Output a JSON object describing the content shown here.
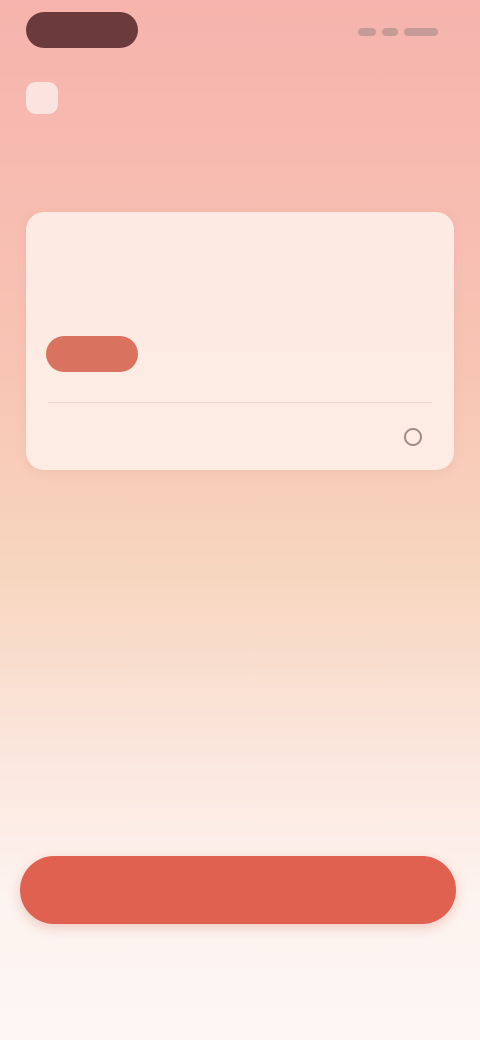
{
  "header": {
    "app_icon": "app-icon",
    "app_label": ""
  },
  "page_title": "",
  "card": {
    "label": "",
    "text": "",
    "tag": "",
    "footer_label": "",
    "footer_value": "",
    "footer_icon": "clock-icon"
  },
  "cta": {
    "label": ""
  },
  "secondary_link": {
    "label": ""
  },
  "colors": {
    "accent": "#e0614f",
    "tag": "#d9735f",
    "title": "#5a3232",
    "card_bg": "#fdefe7"
  }
}
